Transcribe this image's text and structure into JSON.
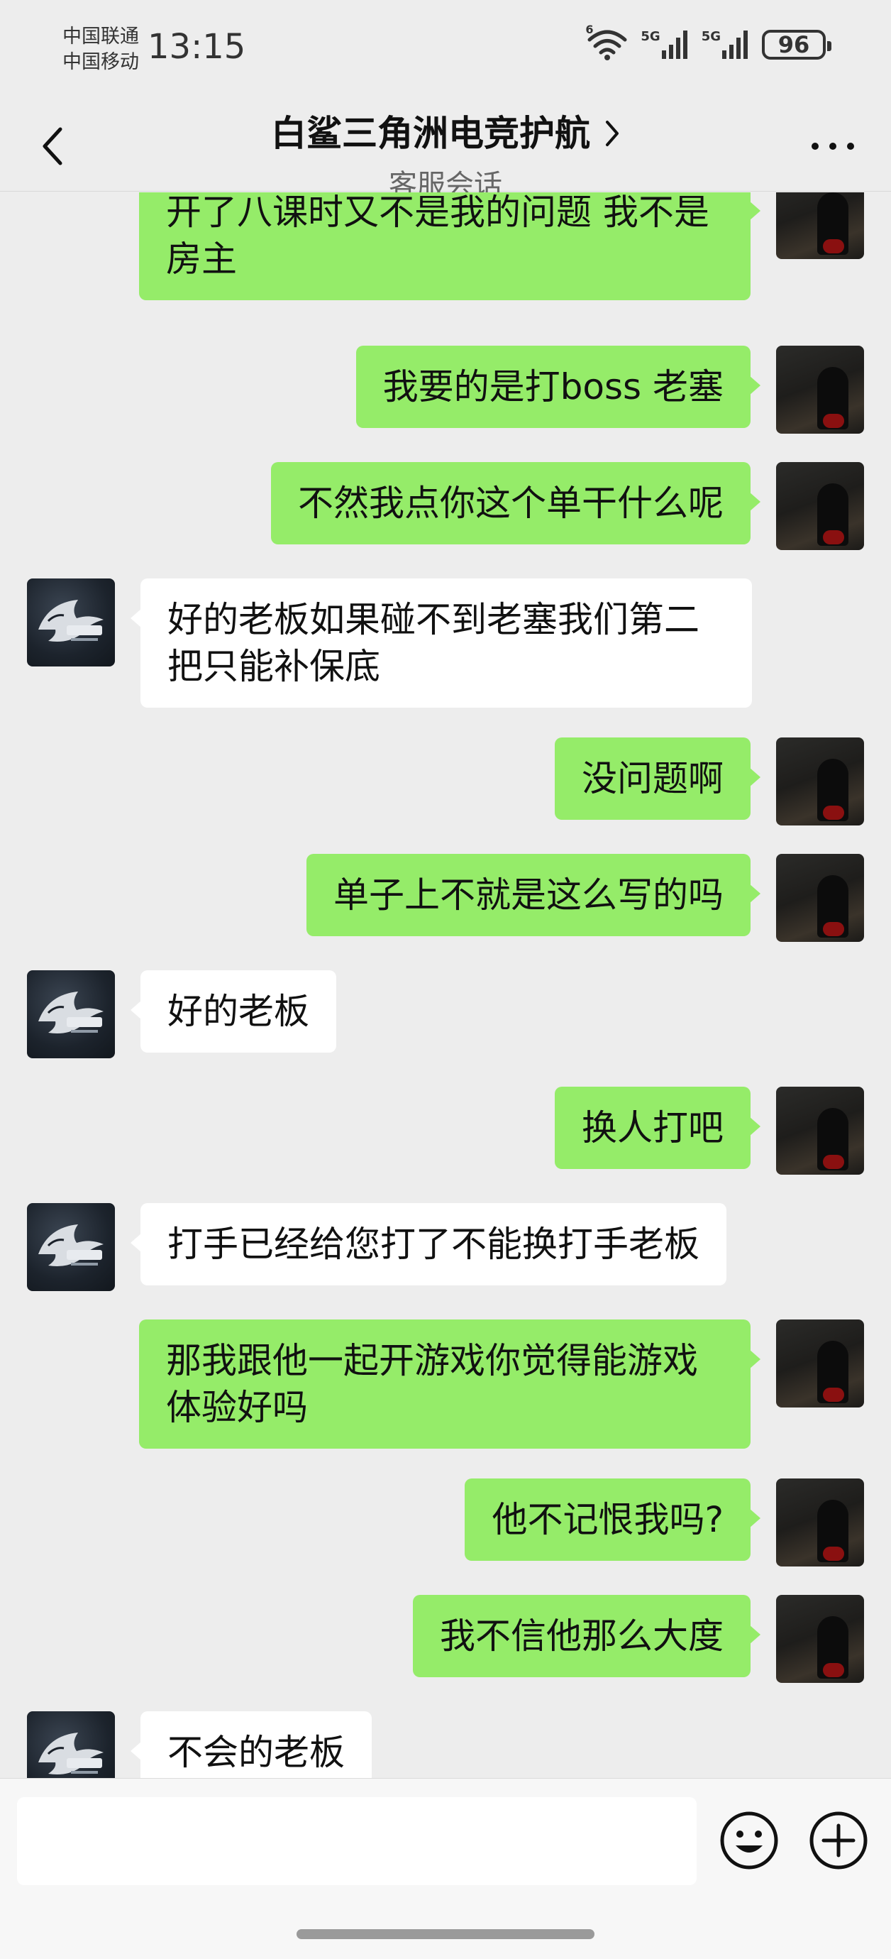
{
  "status_bar": {
    "carrier_1": "中国联通",
    "carrier_2": "中国移动",
    "time": "13:15",
    "wifi_label": "6",
    "signal_1_label": "5G",
    "signal_2_label": "5G",
    "battery": "96"
  },
  "nav": {
    "title": "白鲨三角洲电竞护航",
    "subtitle": "客服会话"
  },
  "messages": [
    {
      "from": "user",
      "text": "开了八课时又不是我的问题  我不是房主"
    },
    {
      "from": "user",
      "text": "我要的是打boss 老塞"
    },
    {
      "from": "user",
      "text": "不然我点你这个单干什么呢"
    },
    {
      "from": "service",
      "text": "好的老板如果碰不到老塞我们第二把只能补保底"
    },
    {
      "from": "user",
      "text": "没问题啊"
    },
    {
      "from": "user",
      "text": "单子上不就是这么写的吗"
    },
    {
      "from": "service",
      "text": "好的老板"
    },
    {
      "from": "user",
      "text": "换人打吧"
    },
    {
      "from": "service",
      "text": "打手已经给您打了不能换打手老板"
    },
    {
      "from": "user",
      "text": "那我跟他一起开游戏你觉得能游戏体验好吗"
    },
    {
      "from": "user",
      "text": "他不记恨我吗?"
    },
    {
      "from": "user",
      "text": "我不信他那么大度"
    },
    {
      "from": "service",
      "text": "不会的老板"
    }
  ],
  "input": {
    "value": "",
    "placeholder": ""
  },
  "icons": {
    "back": "chevron-left-icon",
    "title_chevron": "chevron-right-icon",
    "more": "more-dots-icon",
    "emoji": "emoji-icon",
    "plus": "plus-circle-icon"
  },
  "colors": {
    "user_bubble": "#95ec69",
    "service_bubble": "#ffffff",
    "background": "#ededed"
  }
}
